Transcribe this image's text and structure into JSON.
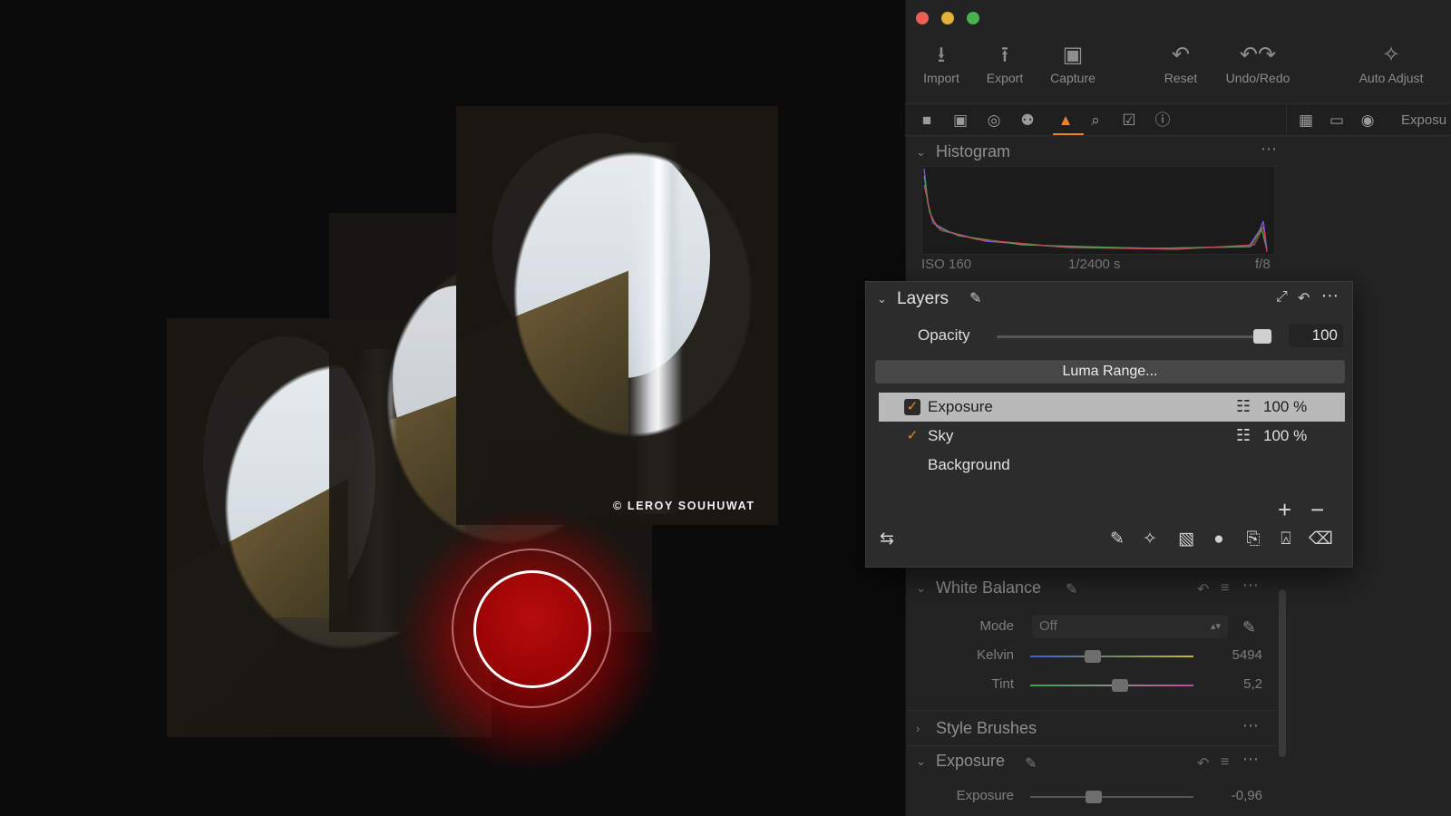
{
  "artwork": {
    "credit": "© LEROY SOUHUWAT"
  },
  "toolbar": {
    "buttons": [
      {
        "label": "Import",
        "icon": "import-icon"
      },
      {
        "label": "Export",
        "icon": "export-icon"
      },
      {
        "label": "Capture",
        "icon": "camera-icon"
      },
      {
        "label": "Reset",
        "icon": "reset-icon"
      },
      {
        "label": "Undo/Redo",
        "icon": "undo-redo-icon"
      },
      {
        "label": "Auto Adjust",
        "icon": "magic-wand-icon"
      }
    ]
  },
  "tabs": {
    "right_text": "Exposu"
  },
  "histogram": {
    "title": "Histogram",
    "iso": "ISO 160",
    "shutter": "1/2400 s",
    "aperture": "f/8"
  },
  "layers_panel": {
    "title": "Layers",
    "opacity_label": "Opacity",
    "opacity_value": "100",
    "opacity_level": 1.0,
    "luma_button": "Luma Range...",
    "layers": [
      {
        "name": "Exposure",
        "checked": true,
        "percent": "100 %",
        "selected": true
      },
      {
        "name": "Sky",
        "checked": true,
        "percent": "100 %",
        "selected": false
      },
      {
        "name": "Background",
        "checked": false,
        "percent": "",
        "selected": false
      }
    ]
  },
  "white_balance": {
    "title": "White Balance",
    "mode_label": "Mode",
    "mode_value": "Off",
    "kelvin_label": "Kelvin",
    "kelvin_value": "5494",
    "tint_label": "Tint",
    "tint_value": "5,2"
  },
  "style_brushes": {
    "title": "Style Brushes"
  },
  "exposure_panel": {
    "title": "Exposure",
    "exposure_label": "Exposure",
    "exposure_value": "-0,96"
  },
  "colors": {
    "accent": "#e8822b",
    "record_red": "#b70d0d",
    "panel_bg": "#2c2c2c"
  }
}
